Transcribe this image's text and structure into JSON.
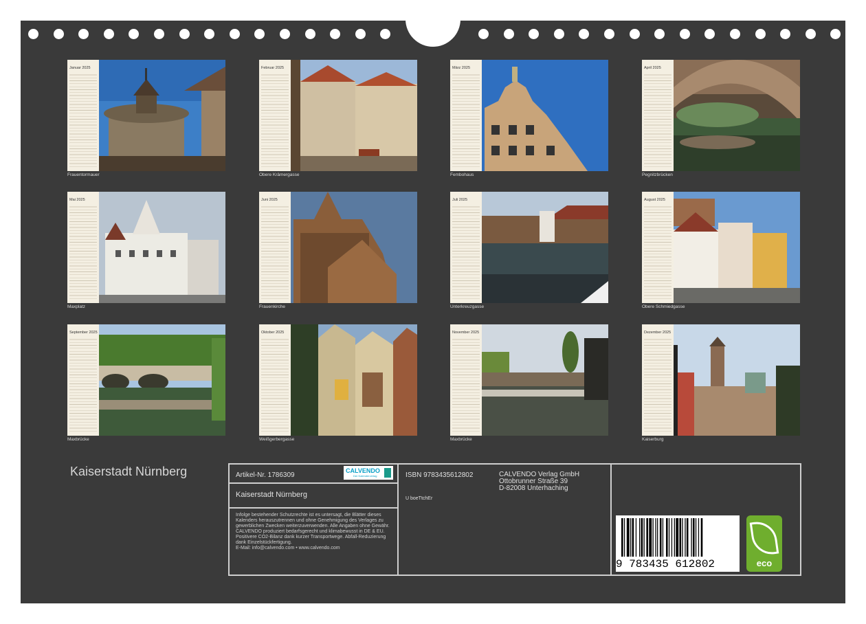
{
  "calendar_title": "Kaiserstadt Nürnberg",
  "months": [
    {
      "month": "Januar",
      "year": "2025",
      "caption": "Frauentormauer"
    },
    {
      "month": "Februar",
      "year": "2025",
      "caption": "Obere Krämergasse"
    },
    {
      "month": "März",
      "year": "2025",
      "caption": "Fembohaus"
    },
    {
      "month": "April",
      "year": "2025",
      "caption": "Pegnitzbrücken"
    },
    {
      "month": "Mai",
      "year": "2025",
      "caption": "Maxplatz"
    },
    {
      "month": "Juni",
      "year": "2025",
      "caption": "Frauenkirche"
    },
    {
      "month": "Juli",
      "year": "2025",
      "caption": "Unterkreuzgasse"
    },
    {
      "month": "August",
      "year": "2025",
      "caption": "Obere Schmiedgasse"
    },
    {
      "month": "September",
      "year": "2025",
      "caption": "Maxbrücke"
    },
    {
      "month": "Oktober",
      "year": "2025",
      "caption": "Weißgerbergasse"
    },
    {
      "month": "November",
      "year": "2025",
      "caption": "Maxbrücke"
    },
    {
      "month": "Dezember",
      "year": "2025",
      "caption": "Kaiserburg"
    }
  ],
  "info": {
    "article": "Artikel-Nr. 1786309",
    "logo_text": "CALVENDO",
    "logo_subtext": "Der Kalenderverlag",
    "product_title": "Kaiserstadt Nürnberg",
    "legal": "Infolge bestehender Schutzrechte ist es untersagt, die Blätter dieses Kalenders herauszutrennen und ohne Genehmigung des Verlages zu gewerblichen Zwecken weiterzuverwenden. Alle Angaben ohne Gewähr.",
    "eco_note": "CALVENDO produziert bedarfsgerecht und klimabewusst in DE & EU. Positivere CO2-Bilanz dank kurzer Transportwege. Abfall-Reduzierung dank Einzelstückfertigung.",
    "contact": "E-Mail: info@calvendo.com • www.calvendo.com",
    "isbn": "ISBN 9783435612802",
    "code": "U boeTtchEr",
    "publisher_name": "CALVENDO Verlag GmbH",
    "publisher_street": "Ottobrunner Straße 39",
    "publisher_city": "D-82008 Unterhaching",
    "barcode_digits": "9 783435 612802",
    "eco_label": "eco"
  },
  "colors": {
    "board": "#3a3a3a",
    "paper_strip": "#f4efe2",
    "eco_green": "#6fae2e",
    "calvendo_blue": "#0aa0c8"
  }
}
